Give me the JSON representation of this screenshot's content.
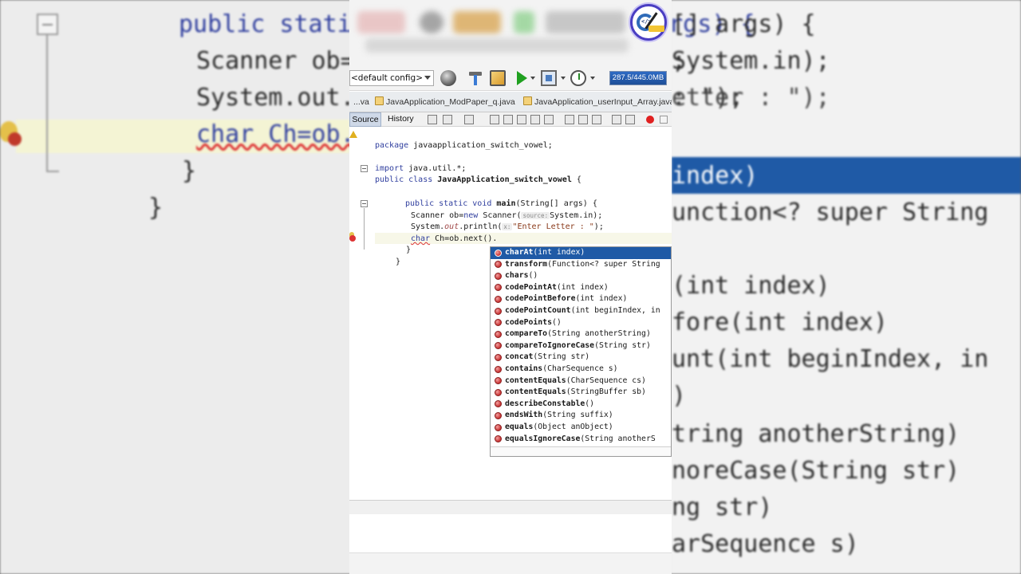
{
  "background": {
    "code_lines": [
      "public static void main(String[] args) {",
      "Scanner ob=new Scanner(System.in);",
      "System.out.println(\"Enter Letter : \");",
      "char Ch=ob.next().",
      "}",
      "}"
    ],
    "right_fragments": [
      "[] args) {",
      "System.in);",
      "etter : \");",
      "index)",
      "unction<? super String",
      "(int index)",
      "fore(int index)",
      "unt(int beginIndex, in",
      ")",
      "tring anotherString)",
      "noreCase(String str)",
      "ng str)",
      "arSequence s)"
    ]
  },
  "toolbar": {
    "config": "<default config>",
    "memory": "287.5/445.0MB"
  },
  "tabs": [
    {
      "label": "...va"
    },
    {
      "label": "JavaApplication_ModPaper_q.java"
    },
    {
      "label": "JavaApplication_userInput_Array.java"
    }
  ],
  "editor_bar": {
    "source": "Source",
    "history": "History"
  },
  "code": {
    "l1_kw": "package",
    "l1_rest": " javaapplication_switch_vowel;",
    "l2_kw": "import",
    "l2_rest": " java.util.*;",
    "l3_kw": "public class",
    "l3_name": "JavaApplication_switch_vowel",
    "l3_rest": " {",
    "l4_kw": "public static void",
    "l4_name": "main",
    "l4_rest": "(String[] args) {",
    "l5_a": "Scanner ob=",
    "l5_kw": "new",
    "l5_b": " Scanner(",
    "l5_hint": "source:",
    "l5_c": "System.in);",
    "l6_a": "System.",
    "l6_fld": "out",
    "l6_b": ".println(",
    "l6_hint": "x:",
    "l6_lit": "\"Enter Letter : \"",
    "l6_c": ");",
    "l7_kw": "char",
    "l7_rest": " Ch=ob.next().",
    "l8": "}",
    "l9": "}"
  },
  "completion": [
    {
      "name": "charAt",
      "params": "(int index)",
      "selected": true
    },
    {
      "name": "transform",
      "params": "(Function<? super String"
    },
    {
      "name": "chars",
      "params": "()"
    },
    {
      "name": "codePointAt",
      "params": "(int index)"
    },
    {
      "name": "codePointBefore",
      "params": "(int index)"
    },
    {
      "name": "codePointCount",
      "params": "(int beginIndex, in"
    },
    {
      "name": "codePoints",
      "params": "()"
    },
    {
      "name": "compareTo",
      "params": "(String anotherString)"
    },
    {
      "name": "compareToIgnoreCase",
      "params": "(String str)"
    },
    {
      "name": "concat",
      "params": "(String str)"
    },
    {
      "name": "contains",
      "params": "(CharSequence s)"
    },
    {
      "name": "contentEquals",
      "params": "(CharSequence cs)"
    },
    {
      "name": "contentEquals",
      "params": "(StringBuffer sb)"
    },
    {
      "name": "describeConstable",
      "params": "()"
    },
    {
      "name": "endsWith",
      "params": "(String suffix)"
    },
    {
      "name": "equals",
      "params": "(Object anObject)"
    },
    {
      "name": "equalsIgnoreCase",
      "params": "(String anotherS"
    }
  ]
}
